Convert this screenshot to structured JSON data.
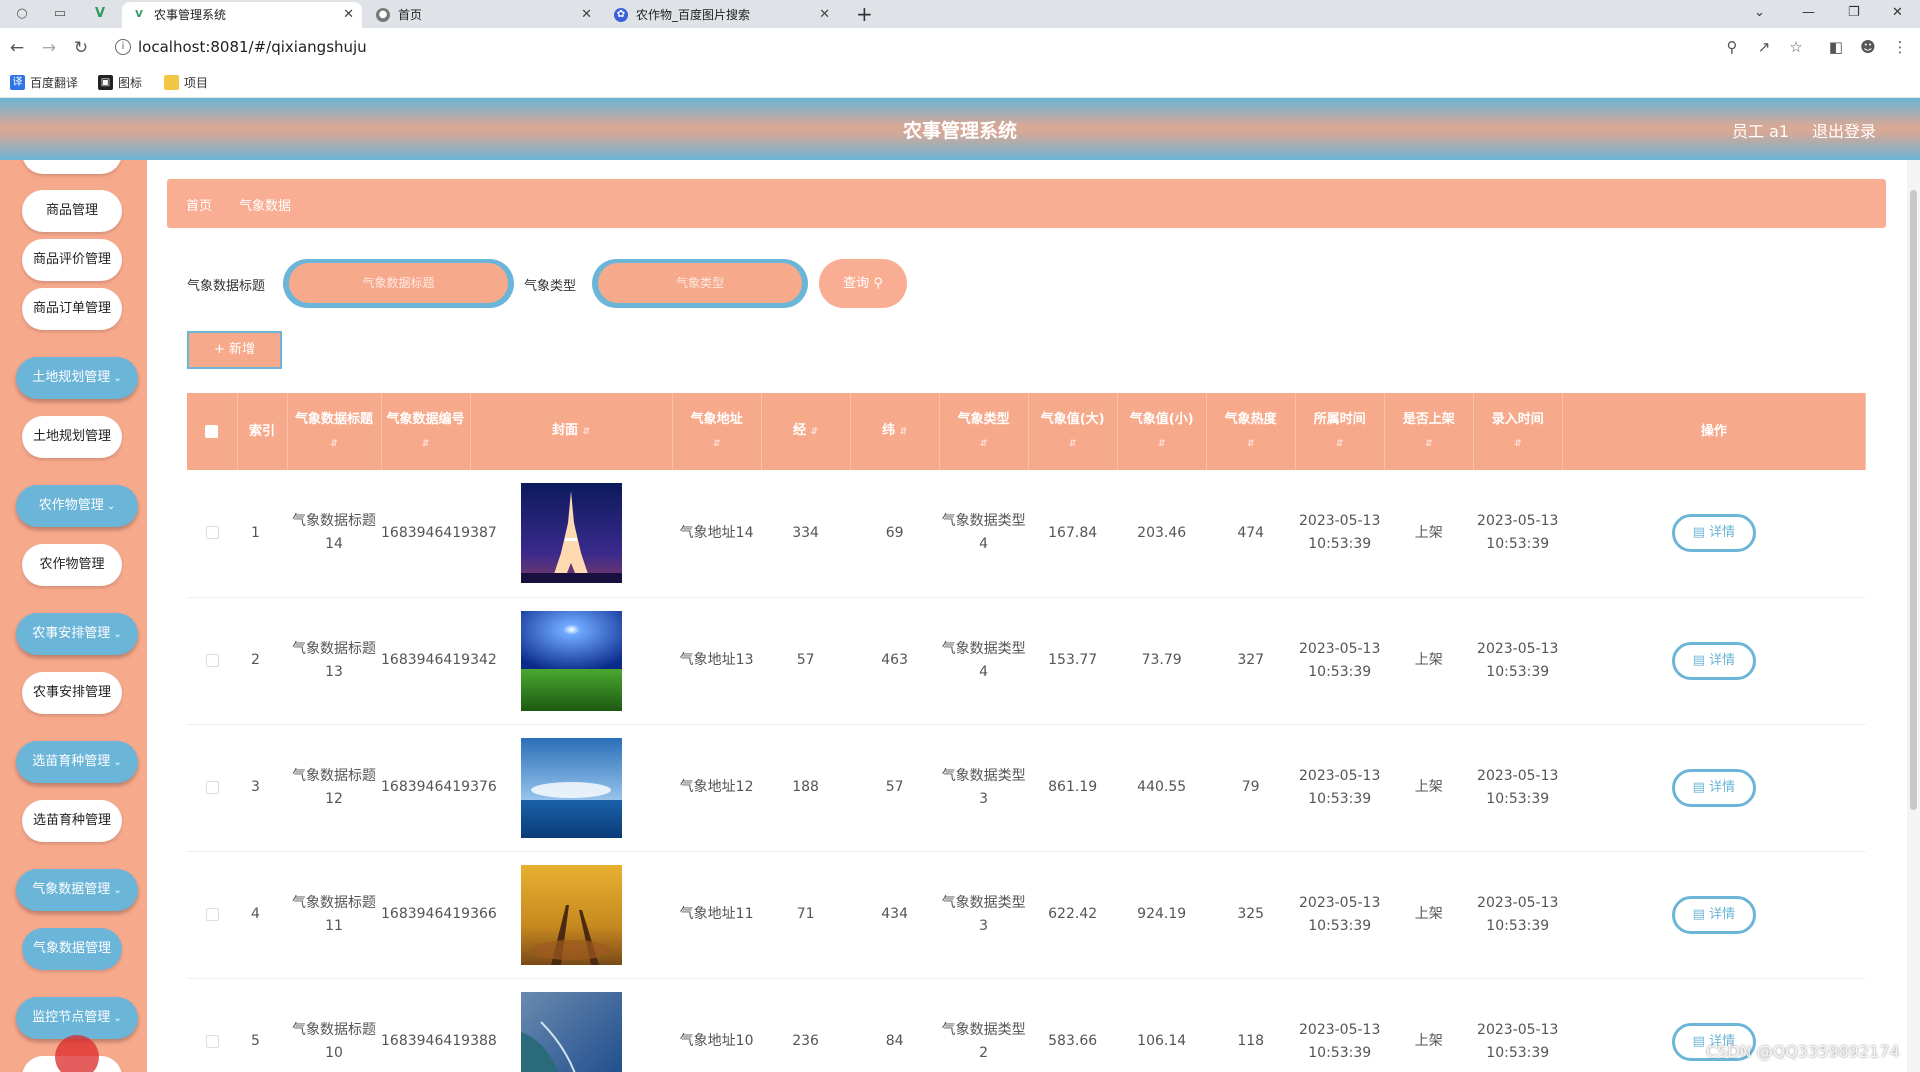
{
  "browser": {
    "tabs": [
      {
        "title": "农事管理系统",
        "active": true
      },
      {
        "title": "首页",
        "active": false
      },
      {
        "title": "农作物_百度图片搜索",
        "active": false
      }
    ],
    "url": "localhost:8081/#/qixiangshuju",
    "bookmarks": [
      "百度翻译",
      "图标",
      "项目"
    ]
  },
  "header": {
    "title": "农事管理系统",
    "user": "员工 a1",
    "logout": "退出登录"
  },
  "sidebar": {
    "items": [
      {
        "label": "商品管理",
        "type": "sub"
      },
      {
        "label": "商品评价管理",
        "type": "sub"
      },
      {
        "label": "商品订单管理",
        "type": "sub"
      },
      {
        "label": "土地规划管理",
        "type": "group"
      },
      {
        "label": "土地规划管理",
        "type": "sub"
      },
      {
        "label": "农作物管理",
        "type": "group"
      },
      {
        "label": "农作物管理",
        "type": "sub"
      },
      {
        "label": "农事安排管理",
        "type": "group"
      },
      {
        "label": "农事安排管理",
        "type": "sub"
      },
      {
        "label": "选苗育种管理",
        "type": "group"
      },
      {
        "label": "选苗育种管理",
        "type": "sub"
      },
      {
        "label": "气象数据管理",
        "type": "group"
      },
      {
        "label": "气象数据管理",
        "type": "sub-selected"
      },
      {
        "label": "监控节点管理",
        "type": "group"
      }
    ]
  },
  "breadcrumb": {
    "home": "首页",
    "current": "气象数据"
  },
  "search": {
    "title_label": "气象数据标题",
    "title_placeholder": "气象数据标题",
    "type_label": "气象类型",
    "type_placeholder": "气象类型",
    "query_button": "查询"
  },
  "toolbar": {
    "add_button": "+ 新增"
  },
  "table": {
    "columns": [
      "索引",
      "气象数据标题",
      "气象数据编号",
      "封面",
      "气象地址",
      "经",
      "纬",
      "气象类型",
      "气象值(大)",
      "气象值(小)",
      "气象热度",
      "所属时间",
      "是否上架",
      "录入时间",
      "操作"
    ],
    "rows": [
      {
        "index": "1",
        "title": "气象数据标题14",
        "code": "1683946419387",
        "cover": "eiffel-tower-night",
        "address": "气象地址14",
        "lng": "334",
        "lat": "69",
        "type": "气象数据类型4",
        "max": "167.84",
        "min": "203.46",
        "heat": "474",
        "time": "2023-05-13 10:53:39",
        "status": "上架",
        "created": "2023-05-13 10:53:39",
        "action": "详情"
      },
      {
        "index": "2",
        "title": "气象数据标题13",
        "code": "1683946419342",
        "cover": "green-field-sun",
        "address": "气象地址13",
        "lng": "57",
        "lat": "463",
        "type": "气象数据类型4",
        "max": "153.77",
        "min": "73.79",
        "heat": "327",
        "time": "2023-05-13 10:53:39",
        "status": "上架",
        "created": "2023-05-13 10:53:39",
        "action": "详情"
      },
      {
        "index": "3",
        "title": "气象数据标题12",
        "code": "1683946419376",
        "cover": "sea-sky",
        "address": "气象地址12",
        "lng": "188",
        "lat": "57",
        "type": "气象数据类型3",
        "max": "861.19",
        "min": "440.55",
        "heat": "79",
        "time": "2023-05-13 10:53:39",
        "status": "上架",
        "created": "2023-05-13 10:53:39",
        "action": "详情"
      },
      {
        "index": "4",
        "title": "气象数据标题11",
        "code": "1683946419366",
        "cover": "autumn-trees",
        "address": "气象地址11",
        "lng": "71",
        "lat": "434",
        "type": "气象数据类型3",
        "max": "622.42",
        "min": "924.19",
        "heat": "325",
        "time": "2023-05-13 10:53:39",
        "status": "上架",
        "created": "2023-05-13 10:53:39",
        "action": "详情"
      },
      {
        "index": "5",
        "title": "气象数据标题10",
        "code": "1683946419388",
        "cover": "coastline",
        "address": "气象地址10",
        "lng": "236",
        "lat": "84",
        "type": "气象数据类型2",
        "max": "583.66",
        "min": "106.14",
        "heat": "118",
        "time": "2023-05-13 10:53:39",
        "status": "上架",
        "created": "2023-05-13 10:53:39",
        "action": "详情"
      }
    ]
  },
  "watermark": "CSDN @QQ3359892174",
  "colors": {
    "accent_blue": "#6bb5d8",
    "accent_salmon": "#f7a98c"
  }
}
